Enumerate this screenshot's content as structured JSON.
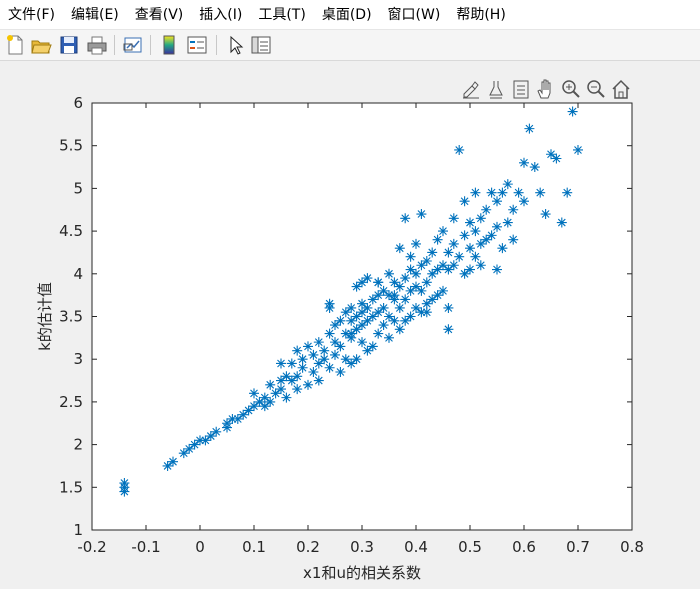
{
  "menu": {
    "items": [
      {
        "id": "file",
        "label": "文件(F)"
      },
      {
        "id": "edit",
        "label": "编辑(E)"
      },
      {
        "id": "view",
        "label": "查看(V)"
      },
      {
        "id": "insert",
        "label": "插入(I)"
      },
      {
        "id": "tools",
        "label": "工具(T)"
      },
      {
        "id": "desktop",
        "label": "桌面(D)"
      },
      {
        "id": "window",
        "label": "窗口(W)"
      },
      {
        "id": "help",
        "label": "帮助(H)"
      }
    ]
  },
  "toolbar": {
    "icons": [
      "new-figure-icon",
      "open-file-icon",
      "save-icon",
      "print-icon",
      "link-plot-icon",
      "colorbar-icon",
      "legend-icon",
      "edit-plot-arrow-icon",
      "property-inspector-icon"
    ]
  },
  "axes_toolbar": {
    "icons": [
      "brush-data-icon",
      "data-tips-icon",
      "export-icon",
      "pan-hand-icon",
      "zoom-in-icon",
      "zoom-out-icon",
      "restore-view-home-icon"
    ]
  },
  "colors": {
    "marker": "#0072bd",
    "axes_bg": "#ffffff",
    "figure_bg": "#f0f0f0"
  },
  "chart_data": {
    "type": "scatter",
    "marker": "asterisk",
    "xlabel": "x1和u的相关系数",
    "ylabel": "k的估计值",
    "title": "",
    "xlim": [
      -0.2,
      0.8
    ],
    "ylim": [
      1,
      6
    ],
    "xticks": [
      "-0.2",
      "-0.1",
      "0",
      "0.1",
      "0.2",
      "0.3",
      "0.4",
      "0.5",
      "0.6",
      "0.7",
      "0.8"
    ],
    "yticks": [
      "1",
      "1.5",
      "2",
      "2.5",
      "3",
      "3.5",
      "4",
      "4.5",
      "5",
      "5.5",
      "6"
    ],
    "grid": false,
    "x": [
      -0.14,
      -0.14,
      -0.14,
      -0.06,
      -0.05,
      -0.03,
      -0.02,
      -0.01,
      0.0,
      0.01,
      0.02,
      0.03,
      0.05,
      0.05,
      0.06,
      0.07,
      0.08,
      0.09,
      0.1,
      0.1,
      0.11,
      0.12,
      0.12,
      0.13,
      0.13,
      0.14,
      0.15,
      0.15,
      0.16,
      0.16,
      0.17,
      0.17,
      0.18,
      0.18,
      0.19,
      0.19,
      0.2,
      0.2,
      0.21,
      0.21,
      0.22,
      0.22,
      0.22,
      0.23,
      0.23,
      0.24,
      0.24,
      0.24,
      0.25,
      0.25,
      0.25,
      0.26,
      0.26,
      0.26,
      0.27,
      0.27,
      0.27,
      0.28,
      0.28,
      0.28,
      0.28,
      0.29,
      0.29,
      0.29,
      0.29,
      0.3,
      0.3,
      0.3,
      0.3,
      0.31,
      0.31,
      0.31,
      0.31,
      0.32,
      0.32,
      0.32,
      0.33,
      0.33,
      0.33,
      0.33,
      0.34,
      0.34,
      0.34,
      0.35,
      0.35,
      0.35,
      0.35,
      0.36,
      0.36,
      0.36,
      0.37,
      0.37,
      0.37,
      0.37,
      0.38,
      0.38,
      0.38,
      0.38,
      0.39,
      0.39,
      0.39,
      0.39,
      0.4,
      0.4,
      0.4,
      0.4,
      0.41,
      0.41,
      0.41,
      0.41,
      0.42,
      0.42,
      0.42,
      0.43,
      0.43,
      0.43,
      0.44,
      0.44,
      0.44,
      0.45,
      0.45,
      0.45,
      0.46,
      0.46,
      0.46,
      0.47,
      0.47,
      0.47,
      0.48,
      0.48,
      0.49,
      0.49,
      0.49,
      0.5,
      0.5,
      0.5,
      0.51,
      0.51,
      0.51,
      0.52,
      0.52,
      0.52,
      0.53,
      0.53,
      0.54,
      0.54,
      0.55,
      0.55,
      0.55,
      0.56,
      0.56,
      0.57,
      0.57,
      0.58,
      0.58,
      0.59,
      0.6,
      0.6,
      0.61,
      0.62,
      0.63,
      0.64,
      0.65,
      0.66,
      0.67,
      0.68,
      0.69,
      0.7,
      0.24,
      0.3,
      0.46,
      0.15,
      0.18,
      0.42,
      0.33,
      0.28,
      0.36
    ],
    "y": [
      1.45,
      1.5,
      1.55,
      1.75,
      1.8,
      1.9,
      1.95,
      2.0,
      2.05,
      2.05,
      2.1,
      2.15,
      2.2,
      2.25,
      2.3,
      2.3,
      2.35,
      2.4,
      2.45,
      2.6,
      2.5,
      2.45,
      2.55,
      2.5,
      2.7,
      2.6,
      2.75,
      2.65,
      2.8,
      2.55,
      2.75,
      2.95,
      2.8,
      2.65,
      2.9,
      3.0,
      2.7,
      3.15,
      2.85,
      3.05,
      2.95,
      3.2,
      2.75,
      3.0,
      3.1,
      2.9,
      3.3,
      3.65,
      3.05,
      3.2,
      3.4,
      2.85,
      3.15,
      3.45,
      3.0,
      3.3,
      3.55,
      2.95,
      3.25,
      3.45,
      3.6,
      3.0,
      3.35,
      3.5,
      3.85,
      3.2,
      3.4,
      3.55,
      3.9,
      3.1,
      3.45,
      3.6,
      3.95,
      3.15,
      3.5,
      3.7,
      3.3,
      3.55,
      3.75,
      3.9,
      3.4,
      3.6,
      3.8,
      3.25,
      3.5,
      3.75,
      4.0,
      3.45,
      3.7,
      3.9,
      3.35,
      3.6,
      3.85,
      4.3,
      3.45,
      3.7,
      3.95,
      4.65,
      3.5,
      3.8,
      4.05,
      4.2,
      3.6,
      3.85,
      4.0,
      4.35,
      3.55,
      3.8,
      4.1,
      4.7,
      3.65,
      3.9,
      4.15,
      3.7,
      4.0,
      4.25,
      3.75,
      4.05,
      4.4,
      3.8,
      4.1,
      4.5,
      3.35,
      4.05,
      4.25,
      4.1,
      4.35,
      4.65,
      4.2,
      5.45,
      4.0,
      4.45,
      4.85,
      4.05,
      4.3,
      4.6,
      4.2,
      4.5,
      4.95,
      4.1,
      4.35,
      4.65,
      4.4,
      4.75,
      4.45,
      4.95,
      4.05,
      4.55,
      4.85,
      4.3,
      4.95,
      4.6,
      5.05,
      4.4,
      4.75,
      4.95,
      4.85,
      5.3,
      5.7,
      5.25,
      4.95,
      4.7,
      5.4,
      5.35,
      4.6,
      4.95,
      5.9,
      5.45,
      3.6,
      3.65,
      3.6,
      2.95,
      3.1,
      3.55,
      3.9,
      3.3,
      3.75
    ]
  }
}
